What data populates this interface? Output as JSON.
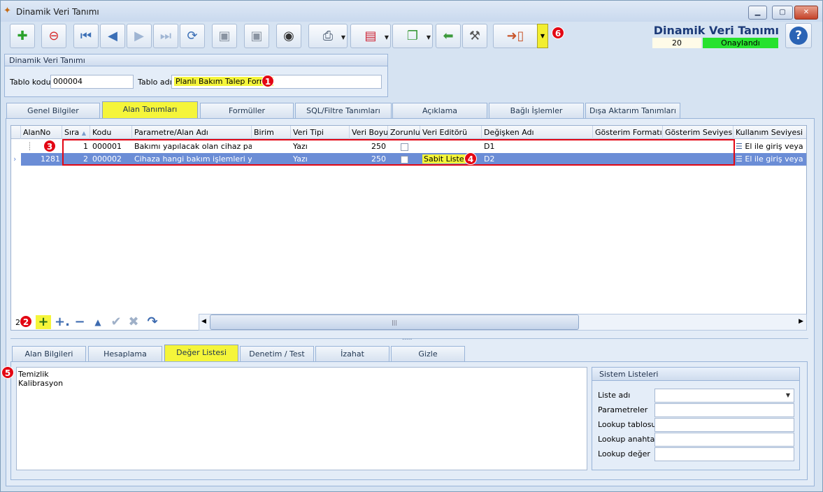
{
  "window": {
    "title": "Dinamik Veri Tanımı"
  },
  "header": {
    "title": "Dinamik Veri Tanımı",
    "count": "20",
    "status": "Onaylandı"
  },
  "group": {
    "title": "Dinamik Veri Tanımı",
    "code_label": "Tablo kodu",
    "code_value": "000004",
    "name_label": "Tablo adı",
    "name_value": "Planlı Bakım Talep Formu"
  },
  "tabs": [
    "Genel Bilgiler",
    "Alan Tanımları",
    "Formüller",
    "SQL/Filtre Tanımları",
    "Açıklama",
    "Bağlı İşlemler",
    "Dışa Aktarım Tanımları"
  ],
  "grid": {
    "columns": [
      "AlanNo",
      "Sıra",
      "Kodu",
      "Parametre/Alan Adı",
      "Birim",
      "Veri Tipi",
      "Veri Boyu",
      "Zorunlu",
      "Veri Editörü",
      "Değişken Adı",
      "Gösterim Formatı",
      "Gösterim Seviyesi",
      "Kullanım Seviyesi"
    ],
    "rows": [
      {
        "alan_no": "",
        "sira": "1",
        "kodu": "000001",
        "ad": "Bakımı yapılacak olan cihaz parçalar",
        "birim": "",
        "tip": "Yazı",
        "boyu": "250",
        "editor": "",
        "degisken": "D1",
        "kullanim": "El ile giriş veya He"
      },
      {
        "alan_no": "1281",
        "sira": "2",
        "kodu": "000002",
        "ad": "Cihaza hangi bakım işlemleri yapılac",
        "birim": "",
        "tip": "Yazı",
        "boyu": "250",
        "editor": "Sabit Liste",
        "degisken": "D2",
        "kullanim": "El ile giriş veya He"
      }
    ],
    "record_count": "2"
  },
  "bottom_tabs": [
    "Alan Bilgileri",
    "Hesaplama",
    "Değer Listesi",
    "Denetim / Test",
    "İzahat",
    "Gizle"
  ],
  "value_list": [
    "Temizlik",
    "Kalibrasyon"
  ],
  "system_lists": {
    "title": "Sistem Listeleri",
    "fields": [
      "Liste adı",
      "Parametreler",
      "Lookup tablosu",
      "Lookup anahtar",
      "Lookup değer"
    ]
  },
  "badges": [
    "1",
    "2",
    "3",
    "4",
    "5",
    "6"
  ],
  "colors": {
    "highlight": "#f5f53a",
    "status_green": "#27e22e",
    "selection": "#6b8dd6",
    "marker": "#e30613"
  }
}
